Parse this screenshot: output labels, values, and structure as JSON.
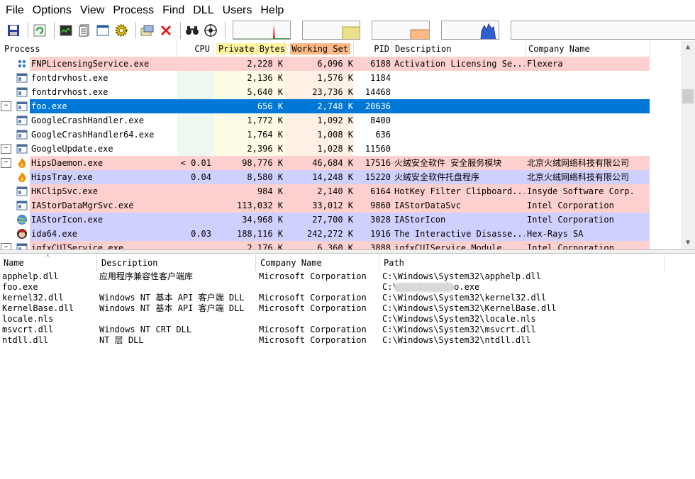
{
  "menu": [
    "File",
    "Options",
    "View",
    "Process",
    "Find",
    "DLL",
    "Users",
    "Help"
  ],
  "toolbar_icons": [
    "save-icon",
    "refresh-icon",
    "system-info-icon",
    "properties-icon",
    "window-icon",
    "settings-gear-icon",
    "process-tree-icon",
    "kill-process-icon",
    "find-binoculars-icon",
    "target-crosshair-icon"
  ],
  "process_table": {
    "columns": [
      "Process",
      "CPU",
      "Private Bytes",
      "Working Set",
      "PID",
      "Description",
      "Company Name"
    ],
    "rows": [
      {
        "expander": "",
        "icon": "service-icon",
        "name": "FNPLicensingService.exe",
        "cpu": "",
        "private": "2,228 K",
        "working": "6,096 K",
        "pid": "6188",
        "desc": "Activation Licensing Se...",
        "company": "Flexera",
        "style": "pink"
      },
      {
        "expander": "",
        "icon": "app-window-icon",
        "name": "fontdrvhost.exe",
        "cpu": "",
        "private": "2,136 K",
        "working": "1,576 K",
        "pid": "1184",
        "desc": "",
        "company": "",
        "style": "normal"
      },
      {
        "expander": "",
        "icon": "app-window-icon",
        "name": "fontdrvhost.exe",
        "cpu": "",
        "private": "5,640 K",
        "working": "23,736 K",
        "pid": "14468",
        "desc": "",
        "company": "",
        "style": "normal"
      },
      {
        "expander": "—",
        "icon": "app-window-icon",
        "name": "foo.exe",
        "cpu": "",
        "private": "656 K",
        "working": "2,748 K",
        "pid": "20636",
        "desc": "",
        "company": "",
        "style": "selected"
      },
      {
        "expander": "",
        "icon": "app-window-icon",
        "name": "GoogleCrashHandler.exe",
        "cpu": "",
        "private": "1,772 K",
        "working": "1,092 K",
        "pid": "8400",
        "desc": "",
        "company": "",
        "style": "normal"
      },
      {
        "expander": "",
        "icon": "app-window-icon",
        "name": "GoogleCrashHandler64.exe",
        "cpu": "",
        "private": "1,764 K",
        "working": "1,008 K",
        "pid": "636",
        "desc": "",
        "company": "",
        "style": "normal"
      },
      {
        "expander": "—",
        "icon": "app-window-icon",
        "name": "GoogleUpdate.exe",
        "cpu": "",
        "private": "2,396 K",
        "working": "1,028 K",
        "pid": "11560",
        "desc": "",
        "company": "",
        "style": "normal"
      },
      {
        "expander": "—",
        "icon": "flame-icon",
        "name": "HipsDaemon.exe",
        "cpu": "< 0.01",
        "private": "98,776 K",
        "working": "46,684 K",
        "pid": "17516",
        "desc": "火绒安全软件 安全服务模块",
        "company": "北京火绒网络科技有限公司",
        "style": "pink"
      },
      {
        "expander": "",
        "icon": "flame-icon",
        "name": "HipsTray.exe",
        "cpu": "0.04",
        "private": "8,580 K",
        "working": "14,248 K",
        "pid": "15220",
        "desc": "火绒安全软件托盘程序",
        "company": "北京火绒网络科技有限公司",
        "style": "blue"
      },
      {
        "expander": "",
        "icon": "app-window-icon",
        "name": "HKClipSvc.exe",
        "cpu": "",
        "private": "984 K",
        "working": "2,140 K",
        "pid": "6164",
        "desc": "HotKey Filter Clipboard...",
        "company": "Insyde Software Corp.",
        "style": "pink"
      },
      {
        "expander": "",
        "icon": "app-window-icon",
        "name": "IAStorDataMgrSvc.exe",
        "cpu": "",
        "private": "113,032 K",
        "working": "33,012 K",
        "pid": "9860",
        "desc": "IAStorDataSvc",
        "company": "Intel Corporation",
        "style": "pink"
      },
      {
        "expander": "",
        "icon": "globe-icon",
        "name": "IAStorIcon.exe",
        "cpu": "",
        "private": "34,968 K",
        "working": "27,700 K",
        "pid": "3028",
        "desc": "IAStorIcon",
        "company": "Intel Corporation",
        "style": "blue"
      },
      {
        "expander": "",
        "icon": "ida-face-icon",
        "name": "ida64.exe",
        "cpu": "0.03",
        "private": "188,116 K",
        "working": "242,272 K",
        "pid": "1916",
        "desc": "The Interactive Disasse...",
        "company": "Hex-Rays SA",
        "style": "blue"
      },
      {
        "expander": "—",
        "icon": "app-window-icon",
        "name": "igfxCUIService.exe",
        "cpu": "",
        "private": "2,176 K",
        "working": "6,360 K",
        "pid": "3888",
        "desc": "igfxCUIService Module",
        "company": "Intel Corporation",
        "style": "pink"
      }
    ]
  },
  "dll_table": {
    "columns": [
      "Name",
      "Description",
      "Company Name",
      "Path"
    ],
    "rows": [
      {
        "name": "apphelp.dll",
        "desc": "应用程序兼容性客户端库",
        "company": "Microsoft Corporation",
        "path": "C:\\Windows\\System32\\apphelp.dll"
      },
      {
        "name": "foo.exe",
        "desc": "",
        "company": "",
        "path": "C:\\                    Desktop\\foo.exe"
      },
      {
        "name": "kernel32.dll",
        "desc": "Windows NT 基本 API 客户端 DLL",
        "company": "Microsoft Corporation",
        "path": "C:\\Windows\\System32\\kernel32.dll"
      },
      {
        "name": "KernelBase.dll",
        "desc": "Windows NT 基本 API 客户端 DLL",
        "company": "Microsoft Corporation",
        "path": "C:\\Windows\\System32\\KernelBase.dll"
      },
      {
        "name": "locale.nls",
        "desc": "",
        "company": "",
        "path": "C:\\Windows\\System32\\locale.nls"
      },
      {
        "name": "msvcrt.dll",
        "desc": "Windows NT CRT DLL",
        "company": "Microsoft Corporation",
        "path": "C:\\Windows\\System32\\msvcrt.dll"
      },
      {
        "name": "ntdll.dll",
        "desc": "NT 层 DLL",
        "company": "Microsoft Corporation",
        "path": "C:\\Windows\\System32\\ntdll.dll"
      }
    ]
  },
  "colors": {
    "service_pink": "#ffd0d0",
    "own_process_blue": "#d0d0ff",
    "selected": "#0078d7",
    "private_bytes_header": "#fff5a0",
    "working_set_header": "#ffb987",
    "cpu_column_tint": "#eef8ee",
    "private_column_tint": "#fffce6",
    "working_column_tint": "#fff1e6"
  }
}
